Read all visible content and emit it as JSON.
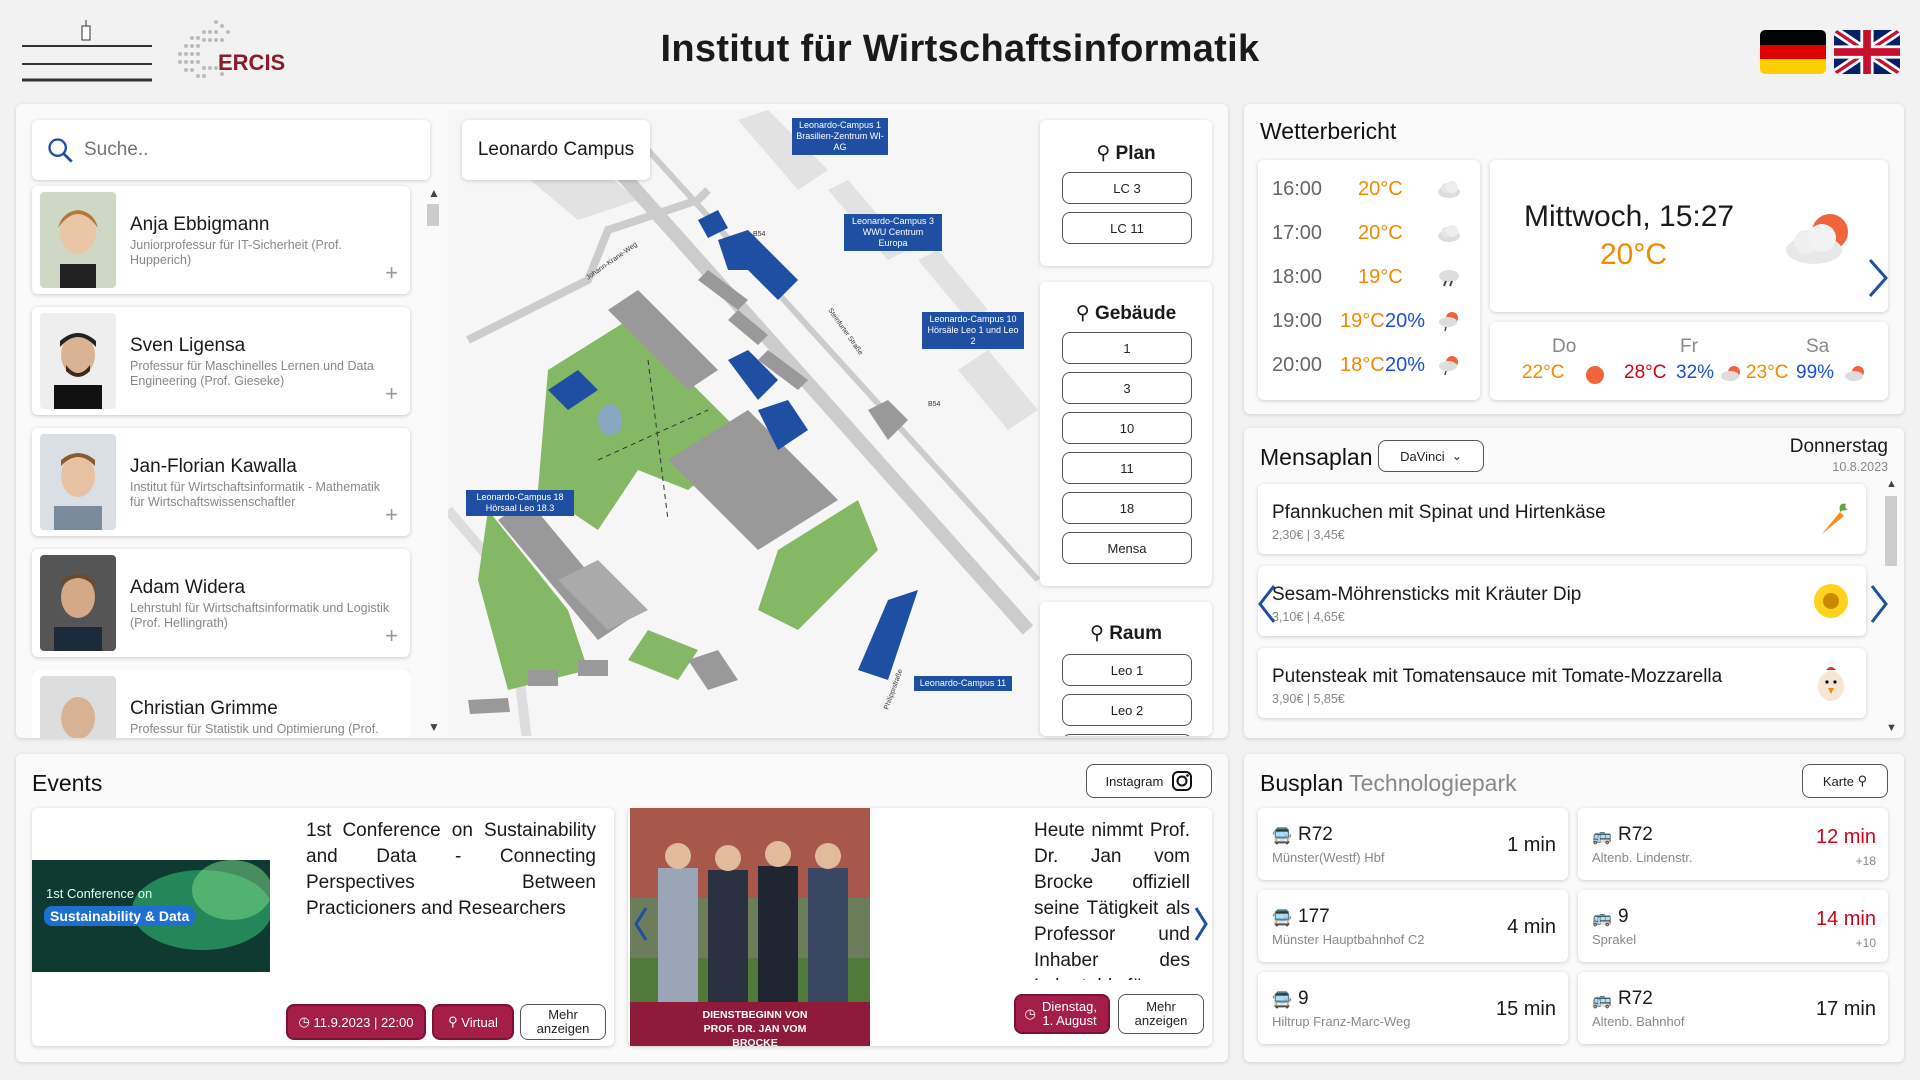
{
  "header": {
    "title": "Institut für Wirtschaftsinformatik",
    "logo_text": "ERCIS",
    "lang_de": "flag-de-icon",
    "lang_en": "flag-uk-icon"
  },
  "search": {
    "placeholder": "Suche.."
  },
  "people": [
    {
      "name": "Anja Ebbigmann",
      "role": "Juniorprofessur für IT-Sicherheit (Prof. Hupperich)"
    },
    {
      "name": "Sven Ligensa",
      "role": "Professur für Maschinelles Lernen und Data Engineering (Prof. Gieseke)"
    },
    {
      "name": "Jan-Florian Kawalla",
      "role": "Institut für Wirtschaftsinformatik - Mathematik für Wirtschaftswissenschaftler"
    },
    {
      "name": "Adam Widera",
      "role": "Lehrstuhl für Wirtschaftsinformatik und Logistik (Prof. Hellingrath)"
    },
    {
      "name": "Christian Grimme",
      "role": "Professur für Statistik und Optimierung (Prof."
    }
  ],
  "map": {
    "campus_label": "Leonardo Campus",
    "labels": [
      "Leonardo-Campus 1 Brasilien-Zentrum WI-AG",
      "Leonardo-Campus 3 WWU Centrum Europa",
      "Leonardo-Campus 10 Hörsäle Leo 1 und Leo 2",
      "Leonardo-Campus 18 Hörsaal Leo 18.3",
      "Leonardo-Campus 11"
    ],
    "streets": [
      "Johann-Krane-Weg",
      "Steinfurter Straße",
      "Philippistraße",
      "B54",
      "B54"
    ]
  },
  "filters": {
    "plan": {
      "title": "Plan",
      "items": [
        "LC 3",
        "LC 11"
      ]
    },
    "gebaeude": {
      "title": "Gebäude",
      "items": [
        "1",
        "3",
        "10",
        "11",
        "18",
        "Mensa"
      ]
    },
    "raum": {
      "title": "Raum",
      "items": [
        "Leo 1",
        "Leo 2"
      ]
    }
  },
  "weather": {
    "title": "Wetterbericht",
    "hourly": [
      {
        "time": "16:00",
        "temp": "20°C",
        "precip": "",
        "icon": "cloud-icon"
      },
      {
        "time": "17:00",
        "temp": "20°C",
        "precip": "",
        "icon": "cloud-icon"
      },
      {
        "time": "18:00",
        "temp": "19°C",
        "precip": "",
        "icon": "rain-cloud-icon"
      },
      {
        "time": "19:00",
        "temp": "19°C",
        "precip": "20%",
        "icon": "sun-rain-icon"
      },
      {
        "time": "20:00",
        "temp": "18°C",
        "precip": "20%",
        "icon": "sun-rain-icon"
      }
    ],
    "now": {
      "label": "Mittwoch, 15:27",
      "temp": "20°C",
      "icon": "sun-cloud-icon"
    },
    "days": [
      {
        "day": "Do",
        "temp": "22°C",
        "precip": "",
        "icon": "sun-icon"
      },
      {
        "day": "Fr",
        "temp": "28°C",
        "precip": "32%",
        "icon": "sun-rain-icon"
      },
      {
        "day": "Sa",
        "temp": "23°C",
        "precip": "99%",
        "icon": "sun-rain-icon"
      }
    ]
  },
  "mensa": {
    "title": "Mensaplan",
    "select": "DaVinci",
    "day": "Donnerstag",
    "date": "10.8.2023",
    "meals": [
      {
        "name": "Pfannkuchen mit Spinat und Hirtenkäse",
        "price": "2,30€ | 3,45€",
        "icon": "carrot-icon"
      },
      {
        "name": "Sesam-Möhrensticks mit Kräuter Dip",
        "price": "3,10€ | 4,65€",
        "icon": "sunflower-icon"
      },
      {
        "name": "Putensteak mit Tomatensauce mit Tomate-Mozzarella",
        "price": "3,90€ | 5,85€",
        "icon": "chicken-icon"
      }
    ]
  },
  "events": {
    "title": "Events",
    "instagram": "Instagram",
    "items": [
      {
        "poster_line1": "1st Conference on",
        "poster_line2": "Sustainability & Data",
        "text": "1st Conference on Sustainability and Data - Connecting Perspectives Between Practicioners and Researchers",
        "date": "11.9.2023 | 22:00",
        "location": "Virtual",
        "more": "Mehr anzeigen"
      },
      {
        "poster_caption": "DIENSTBEGINN VON PROF. DR. JAN VOM BROCKE",
        "text": "Heute nimmt Prof. Dr. Jan vom Brocke offiziell seine Tätigkeit als Professor und Inhaber des Lehrstuhls für",
        "date": "Dienstag, 1. August",
        "more": "Mehr anzeigen"
      }
    ]
  },
  "bus": {
    "title": "Busplan",
    "subtitle": "Technologiepark",
    "map_btn": "Karte",
    "left": [
      {
        "line": "R72",
        "stop": "Münster(Westf) Hbf",
        "time": "1 min",
        "delay": ""
      },
      {
        "line": "177",
        "stop": "Münster Hauptbahnhof C2",
        "time": "4 min",
        "delay": ""
      },
      {
        "line": "9",
        "stop": "Hiltrup Franz-Marc-Weg",
        "time": "15 min",
        "delay": ""
      }
    ],
    "right": [
      {
        "line": "R72",
        "stop": "Altenb. Lindenstr.",
        "time": "12 min",
        "delay": "+18"
      },
      {
        "line": "9",
        "stop": "Sprakel",
        "time": "14 min",
        "delay": "+10"
      },
      {
        "line": "R72",
        "stop": "Altenb. Bahnhof",
        "time": "17 min",
        "delay": ""
      }
    ]
  },
  "colors": {
    "accent": "#a51e4a",
    "orange": "#f08a00",
    "blue": "#1a4fd6",
    "red": "#d0021b",
    "map_blue": "#1e4fa3"
  }
}
